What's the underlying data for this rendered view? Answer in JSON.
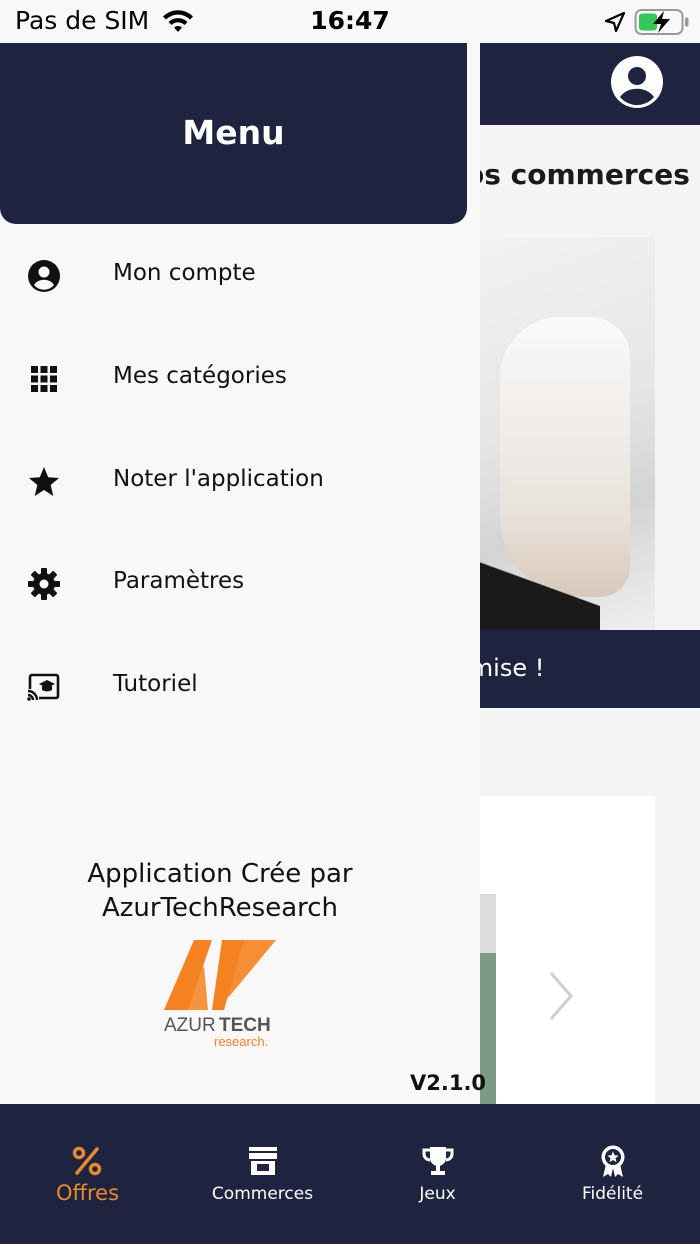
{
  "status_bar": {
    "carrier": "Pas de SIM",
    "time": "16:47",
    "icons": [
      "wifi-icon",
      "location-arrow-icon",
      "battery-charging-icon"
    ]
  },
  "background": {
    "section_title": "os commerces",
    "banner_text": "emise !",
    "icons": [
      "account-icon",
      "chevron-right-icon"
    ]
  },
  "drawer": {
    "title": "Menu",
    "items": [
      {
        "label": "Mon compte",
        "icon": "account-circle-icon"
      },
      {
        "label": "Mes catégories",
        "icon": "grid-icon"
      },
      {
        "label": "Noter l'application",
        "icon": "star-icon"
      },
      {
        "label": "Paramètres",
        "icon": "gear-icon"
      },
      {
        "label": "Tutoriel",
        "icon": "cast-tutorial-icon"
      }
    ],
    "credits_line1": "Application Crée par",
    "credits_line2": "AzurTechResearch",
    "logo": {
      "brand_first": "AZUR",
      "brand_second": "TECH",
      "tagline": "research."
    },
    "version": "V2.1.0"
  },
  "tabbar": {
    "tabs": [
      {
        "label": "Offres",
        "icon": "percent-icon",
        "active": true
      },
      {
        "label": "Commerces",
        "icon": "storefront-icon",
        "active": false
      },
      {
        "label": "Jeux",
        "icon": "trophy-icon",
        "active": false
      },
      {
        "label": "Fidélité",
        "icon": "award-badge-icon",
        "active": false
      }
    ]
  },
  "colors": {
    "navy": "#1e2340",
    "accent": "#e88a2e",
    "drawer_bg": "#f8f8f8"
  }
}
